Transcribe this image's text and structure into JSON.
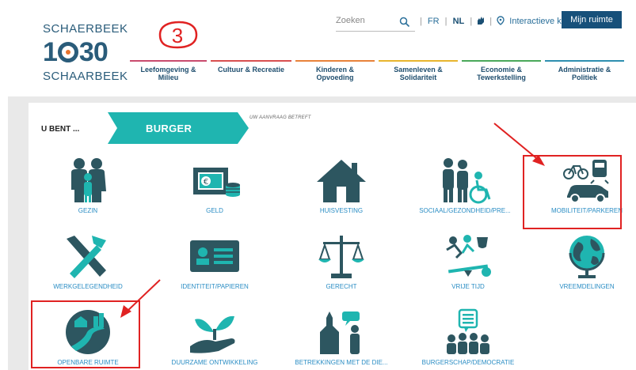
{
  "header": {
    "logo": {
      "line1": "SCHAERBEEK",
      "number": "1030",
      "line2": "SCHAARBEEK"
    },
    "annotation_mark": "3",
    "search": {
      "placeholder": "Zoeken"
    },
    "lang_fr": "FR",
    "lang_nl": "NL",
    "map_link": "Interactieve kaart",
    "my_space_button": "Mijn ruimte"
  },
  "nav": {
    "items": [
      {
        "line1": "Leefomgeving &",
        "line2": "Milieu",
        "color": "#c94b6e"
      },
      {
        "line1": "Cultuur & Recreatie",
        "line2": "",
        "color": "#d84f4f"
      },
      {
        "line1": "Kinderen &",
        "line2": "Opvoeding",
        "color": "#e8823a"
      },
      {
        "line1": "Samenleven &",
        "line2": "Solidariteit",
        "color": "#e8b52e"
      },
      {
        "line1": "Economie &",
        "line2": "Tewerkstelling",
        "color": "#4aa85a"
      },
      {
        "line1": "Administratie &",
        "line2": "Politiek",
        "color": "#2e8fb0"
      }
    ]
  },
  "profile": {
    "you_are_label": "U BENT ...",
    "selected": "BURGER",
    "request_label": "UW AANVRAAG BETREFT"
  },
  "categories": [
    {
      "label": "GEZIN",
      "icon": "family-icon"
    },
    {
      "label": "GELD",
      "icon": "money-icon"
    },
    {
      "label": "HUISVESTING",
      "icon": "house-icon"
    },
    {
      "label": "SOCIAAL/GEZONDHEID/PRE...",
      "icon": "social-health-icon"
    },
    {
      "label": "MOBILITEIT/PARKEREN",
      "icon": "mobility-icon"
    },
    {
      "label": "WERKGELEGENDHEID",
      "icon": "tools-icon"
    },
    {
      "label": "IDENTITEIT/PAPIEREN",
      "icon": "id-card-icon"
    },
    {
      "label": "GERECHT",
      "icon": "scales-icon"
    },
    {
      "label": "VRIJE TIJD",
      "icon": "leisure-icon"
    },
    {
      "label": "VREEMDELINGEN",
      "icon": "globe-icon"
    },
    {
      "label": "OPENBARE RUIMTE",
      "icon": "public-space-icon"
    },
    {
      "label": "DUURZAME ONTWIKKELING",
      "icon": "plant-hand-icon"
    },
    {
      "label": "BETREKKINGEN MET DE DIE...",
      "icon": "city-hall-icon"
    },
    {
      "label": "BURGERSCHAP/DEMOCRATIE",
      "icon": "citizenship-icon"
    }
  ],
  "colors": {
    "brand": "#2a5c7a",
    "teal": "#1fb5b0",
    "link": "#2a8dc4",
    "icon": "#2d5660",
    "annotation_red": "#e02222"
  }
}
